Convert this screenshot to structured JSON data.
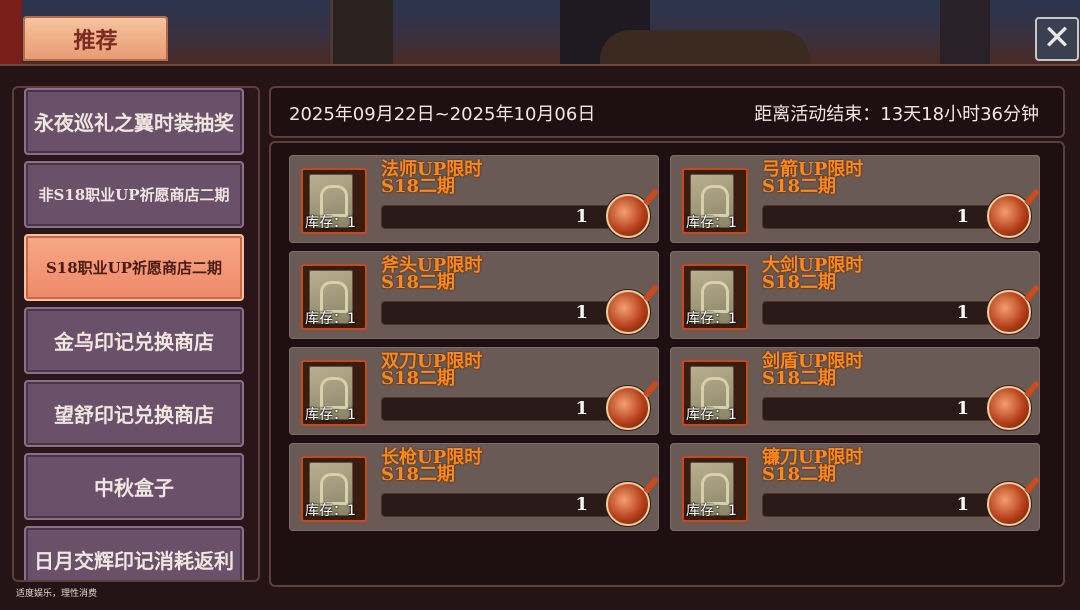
{
  "header": {
    "tab_label": "推荐",
    "close_glyph": "✕"
  },
  "sidebar": {
    "items": [
      {
        "label": "永夜巡礼之翼时装抽奖",
        "active": false
      },
      {
        "label": "非S18职业UP祈愿商店二期",
        "active": false
      },
      {
        "label": "S18职业UP祈愿商店二期",
        "active": true
      },
      {
        "label": "金乌印记兑换商店",
        "active": false
      },
      {
        "label": "望舒印记兑换商店",
        "active": false
      },
      {
        "label": "中秋盒子",
        "active": false
      },
      {
        "label": "日月交辉印记消耗返利",
        "active": false
      }
    ]
  },
  "event": {
    "dates": "2025年09月22日~2025年10月06日",
    "countdown": "距离活动结束：13天18小时36分钟"
  },
  "shop": {
    "items": [
      {
        "name": "法师UP限时",
        "subtitle": "S18二期",
        "stock": "库存：1",
        "price": "1",
        "icon": "class-card-icon",
        "currency_icon": "red-coin-icon"
      },
      {
        "name": "弓箭UP限时",
        "subtitle": "S18二期",
        "stock": "库存：1",
        "price": "1",
        "icon": "class-card-icon",
        "currency_icon": "red-coin-icon"
      },
      {
        "name": "斧头UP限时",
        "subtitle": "S18二期",
        "stock": "库存：1",
        "price": "1",
        "icon": "class-card-icon",
        "currency_icon": "red-coin-icon"
      },
      {
        "name": "大剑UP限时",
        "subtitle": "S18二期",
        "stock": "库存：1",
        "price": "1",
        "icon": "class-card-icon",
        "currency_icon": "red-coin-icon"
      },
      {
        "name": "双刀UP限时",
        "subtitle": "S18二期",
        "stock": "库存：1",
        "price": "1",
        "icon": "class-card-icon",
        "currency_icon": "red-coin-icon"
      },
      {
        "name": "剑盾UP限时",
        "subtitle": "S18二期",
        "stock": "库存：1",
        "price": "1",
        "icon": "class-card-icon",
        "currency_icon": "red-coin-icon"
      },
      {
        "name": "长枪UP限时",
        "subtitle": "S18二期",
        "stock": "库存：1",
        "price": "1",
        "icon": "class-card-icon",
        "currency_icon": "red-coin-icon"
      },
      {
        "name": "镰刀UP限时",
        "subtitle": "S18二期",
        "stock": "库存：1",
        "price": "1",
        "icon": "class-card-icon",
        "currency_icon": "red-coin-icon"
      }
    ]
  },
  "footer": {
    "notice": "适度娱乐，理性消费"
  },
  "colors": {
    "item_name": "#ff8a1a",
    "active_tab": "#ee8868",
    "sidebar_item": "#6a5068"
  }
}
